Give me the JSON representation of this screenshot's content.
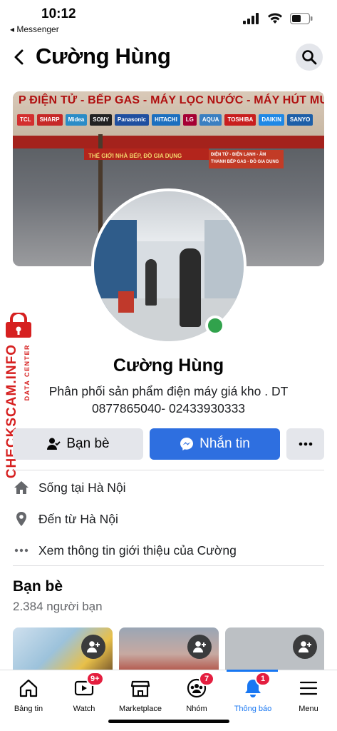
{
  "status_bar": {
    "time": "10:12",
    "back_app": "◂ Messenger"
  },
  "header": {
    "title": "Cường Hùng"
  },
  "cover": {
    "sign_title": "P ĐIỆN TỬ - BẾP GAS - MÁY LỌC NƯỚC - MÁY HÚT MÙI - ĐỒ GIA DỤNG",
    "brands": [
      "TCL",
      "SHARP",
      "Midea",
      "SONY",
      "Panasonic",
      "HITACHI",
      "LG",
      "AQUA",
      "TOSHIBA",
      "DAIKIN",
      "SANYO"
    ],
    "brand_colors": [
      "#d32f2f",
      "#c62828",
      "#2a8cc7",
      "#222222",
      "#1f4fa0",
      "#1b6fbf",
      "#a50034",
      "#3a7fc1",
      "#c81e1e",
      "#1e88e5",
      "#1d5fa8"
    ],
    "shop_sign": "THẾ GIỚI NHÀ BẾP, ĐỒ GIA DỤNG",
    "shop_sign2": "ĐIỆN TỬ - ĐIỆN LẠNH - ÂM THANH BẾP GAS - ĐỒ GIA DỤNG"
  },
  "watermark": {
    "main": "CHECKSCAM.INFO",
    "sub": "DATA CENTER"
  },
  "profile": {
    "name": "Cường Hùng",
    "bio": "Phân phối sản phẩm điện máy giá kho . DT 0877865040- 02433930333",
    "online_color": "#31a24c"
  },
  "actions": {
    "friends_label": "Bạn bè",
    "message_label": "Nhắn tin",
    "accent": "#2e6fe0"
  },
  "info": {
    "lives_prefix": "Sống tại ",
    "lives_city": "Hà Nội",
    "from_prefix": "Đến từ ",
    "from_city": "Hà Nội",
    "see_about": "Xem thông tin giới thiệu của Cường"
  },
  "friends": {
    "title": "Bạn bè",
    "count": "2.384 người bạn"
  },
  "bottom_nav": {
    "items": [
      {
        "label": "Bảng tin",
        "icon": "home-icon",
        "badge": ""
      },
      {
        "label": "Watch",
        "icon": "watch-icon",
        "badge": "9+"
      },
      {
        "label": "Marketplace",
        "icon": "marketplace-icon",
        "badge": ""
      },
      {
        "label": "Nhóm",
        "icon": "groups-icon",
        "badge": "7"
      },
      {
        "label": "Thông báo",
        "icon": "bell-icon",
        "badge": "1"
      },
      {
        "label": "Menu",
        "icon": "menu-icon",
        "badge": ""
      }
    ],
    "active_color": "#1877f2",
    "badge_color": "#e41e3f"
  }
}
